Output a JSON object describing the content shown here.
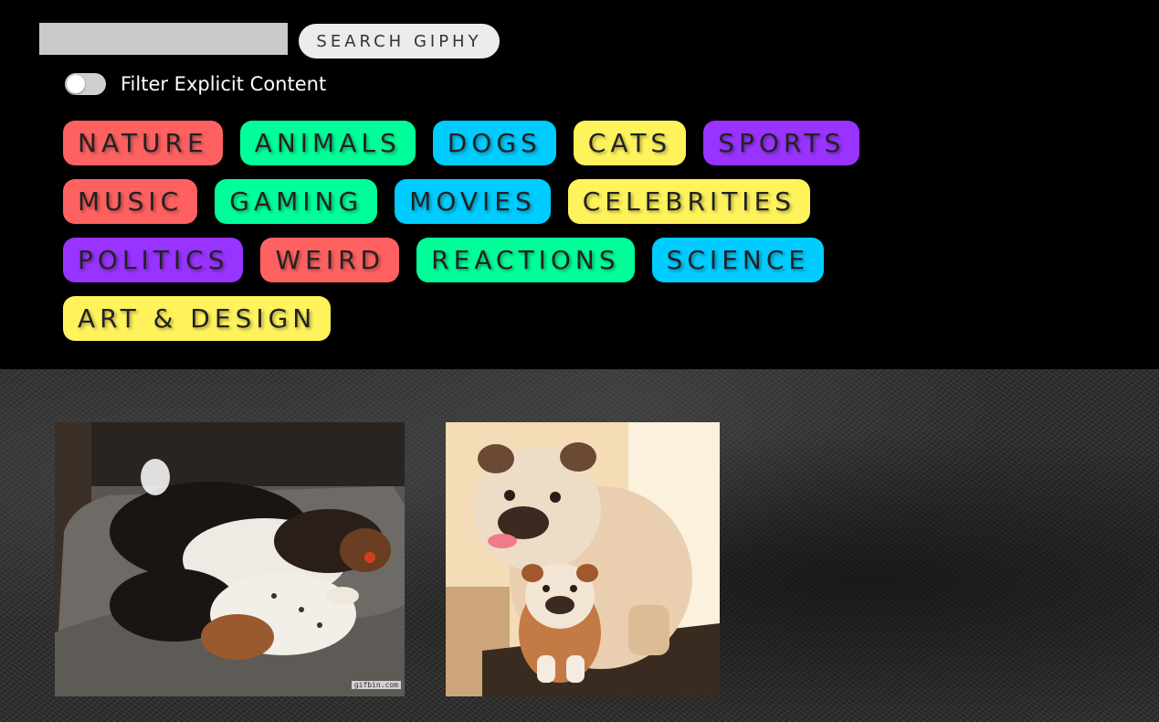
{
  "search": {
    "value": "",
    "placeholder": "",
    "button_label": "SEARCH GIPHY"
  },
  "filter": {
    "label": "Filter Explicit Content",
    "enabled": false
  },
  "tags": [
    {
      "label": "NATURE",
      "color": "#ff6161"
    },
    {
      "label": "ANIMALS",
      "color": "#00ff99"
    },
    {
      "label": "DOGS",
      "color": "#00ccff"
    },
    {
      "label": "CATS",
      "color": "#fff35c"
    },
    {
      "label": "SPORTS",
      "color": "#9933ff"
    },
    {
      "label": "MUSIC",
      "color": "#ff6161"
    },
    {
      "label": "GAMING",
      "color": "#00ff99"
    },
    {
      "label": "MOVIES",
      "color": "#00ccff"
    },
    {
      "label": "CELEBRITIES",
      "color": "#fff35c"
    },
    {
      "label": "POLITICS",
      "color": "#9933ff"
    },
    {
      "label": "WEIRD",
      "color": "#ff6161"
    },
    {
      "label": "REACTIONS",
      "color": "#00ff99"
    },
    {
      "label": "SCIENCE",
      "color": "#00ccff"
    },
    {
      "label": "ART & DESIGN",
      "color": "#fff35c"
    }
  ],
  "gifs": [
    {
      "name": "sleeping-basset-hounds",
      "watermark": "gifbin.com"
    },
    {
      "name": "bulldog-and-puppy",
      "watermark": ""
    }
  ],
  "colors": {
    "header_bg": "#000000",
    "input_bg": "#c9c9c9",
    "button_bg": "#ececec"
  }
}
